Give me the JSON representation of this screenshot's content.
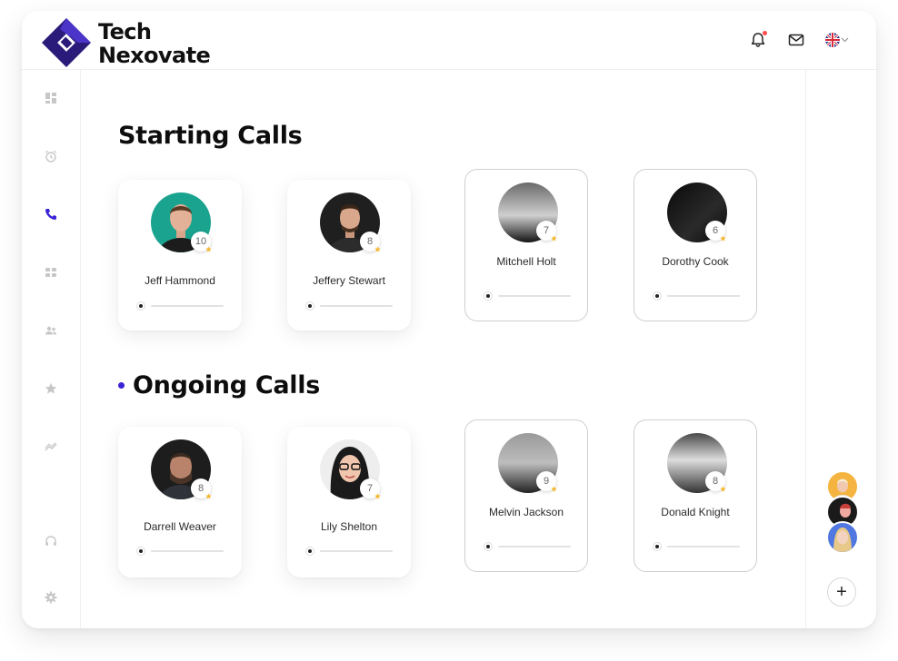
{
  "brand": {
    "line1": "Tech",
    "line2": "Nexovate",
    "accent": "#3b23d6",
    "logo_dark": "#2a1b7a"
  },
  "header": {
    "icons": [
      "bell-icon",
      "mail-icon",
      "uk-flag-icon",
      "chevron-down-icon"
    ],
    "notification_dot_color": "#ff4d4d"
  },
  "sidebar": {
    "items": [
      {
        "icon": "dashboard-icon",
        "active": false
      },
      {
        "icon": "alarm-clock-icon",
        "active": false
      },
      {
        "icon": "phone-icon",
        "active": true
      },
      {
        "icon": "cards-icon",
        "active": false
      },
      {
        "icon": "users-icon",
        "active": false
      },
      {
        "icon": "star-icon",
        "active": false
      },
      {
        "icon": "trend-icon",
        "active": false
      },
      {
        "icon": "headset-icon",
        "active": false
      },
      {
        "icon": "settings-icon",
        "active": false
      }
    ]
  },
  "sections": {
    "starting": {
      "title": "Starting Calls",
      "cards": [
        {
          "name": "Jeff Hammond",
          "count": "10",
          "style": "shadow",
          "avatar_bg": "#1aa38f"
        },
        {
          "name": "Jeffery Stewart",
          "count": "8",
          "style": "shadow",
          "avatar_bg": "#1f1f1f"
        },
        {
          "name": "Mitchell Holt",
          "count": "7",
          "style": "outline",
          "avatar_bg": "#3a3a3a"
        },
        {
          "name": "Dorothy Cook",
          "count": "6",
          "style": "outline",
          "avatar_bg": "#0f0f0f"
        }
      ]
    },
    "ongoing": {
      "title": "Ongoing Calls",
      "cards": [
        {
          "name": "Darrell Weaver",
          "count": "8",
          "style": "shadow",
          "avatar_bg": "#1d1d1d"
        },
        {
          "name": "Lily Shelton",
          "count": "7",
          "style": "shadow",
          "avatar_bg": "#eeeeee"
        },
        {
          "name": "Melvin Jackson",
          "count": "9",
          "style": "outline",
          "avatar_bg": "#555555"
        },
        {
          "name": "Donald Knight",
          "count": "8",
          "style": "outline",
          "avatar_bg": "#666666"
        }
      ]
    }
  },
  "rightbar": {
    "avatars": [
      "user-avatar-1",
      "user-avatar-2",
      "user-avatar-3"
    ],
    "add_label": "+"
  }
}
